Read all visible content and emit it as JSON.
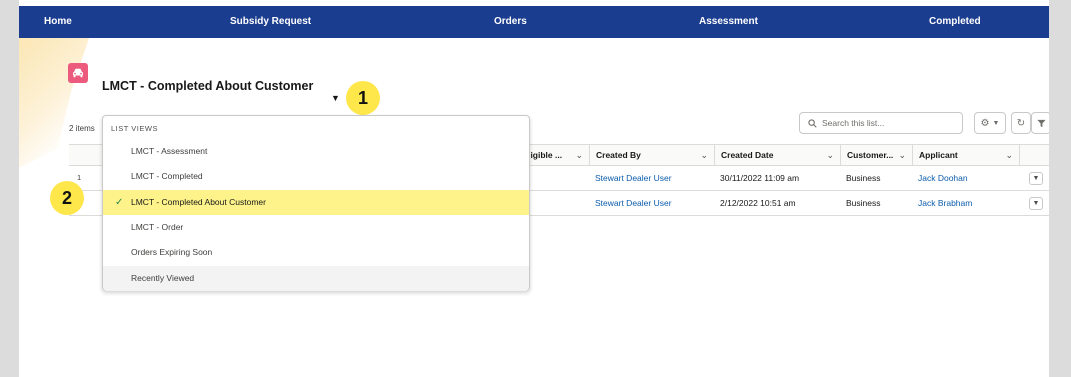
{
  "nav": {
    "items": [
      "Home",
      "Subsidy Request",
      "Orders",
      "Assessment",
      "Completed"
    ]
  },
  "list": {
    "title": "LMCT - Completed About Customer",
    "items_count": "2 items",
    "search_placeholder": "Search this list..."
  },
  "dropdown": {
    "header": "LIST VIEWS",
    "items": [
      "LMCT - Assessment",
      "LMCT - Completed",
      "LMCT - Completed About Customer",
      "LMCT - Order",
      "Orders Expiring Soon",
      "Recently Viewed"
    ],
    "selected": "LMCT - Completed About Customer"
  },
  "table": {
    "columns": [
      "...ligible ...",
      "Created By",
      "Created Date",
      "Customer...",
      "Applicant"
    ],
    "rows": [
      {
        "num": "1",
        "created_by": "Stewart Dealer User",
        "created_date": "30/11/2022 11:09 am",
        "customer": "Business",
        "applicant": "Jack Doohan"
      },
      {
        "num": "2",
        "created_by": "Stewart Dealer User",
        "created_date": "2/12/2022 10:51 am",
        "customer": "Business",
        "applicant": "Jack Brabham"
      }
    ]
  },
  "badges": [
    "1",
    "2"
  ],
  "icons": {
    "object": "car-icon",
    "caret": "caret-down-icon",
    "search": "search-icon",
    "settings": "gear-icon",
    "refresh": "refresh-icon",
    "filter": "filter-icon",
    "check": "check-icon",
    "row_action": "chevron-down-icon"
  },
  "colors": {
    "nav_bg": "#1b3d8f",
    "object_icon": "#ec5b7d",
    "badge": "#fde74a",
    "highlight": "#fdf38a",
    "link": "#0b5cab",
    "check": "#2e844a"
  }
}
